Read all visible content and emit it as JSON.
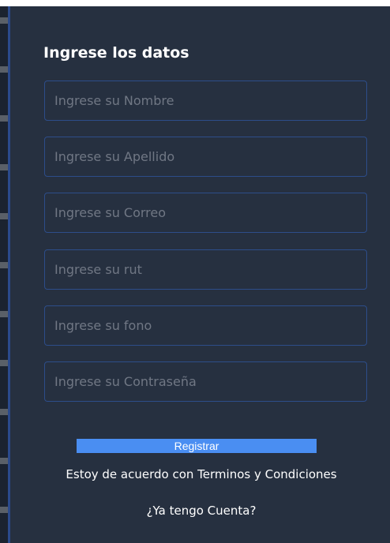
{
  "form": {
    "title": "Ingrese los datos",
    "fields": [
      {
        "placeholder": "Ingrese su Nombre",
        "value": ""
      },
      {
        "placeholder": "Ingrese su Apellido",
        "value": ""
      },
      {
        "placeholder": "Ingrese su Correo",
        "value": ""
      },
      {
        "placeholder": "Ingrese su rut",
        "value": ""
      },
      {
        "placeholder": "Ingrese su fono",
        "value": ""
      },
      {
        "placeholder": "Ingrese su Contraseña",
        "value": ""
      }
    ],
    "register_label": "Registrar",
    "terms_text": "Estoy de acuerdo con Terminos y Condiciones",
    "login_link": "¿Ya tengo Cuenta?"
  },
  "colors": {
    "panel_bg": "#263040",
    "field_border": "#2d4d8a",
    "button_bg": "#4a8ef2",
    "text": "#ffffff",
    "placeholder": "#707784"
  }
}
